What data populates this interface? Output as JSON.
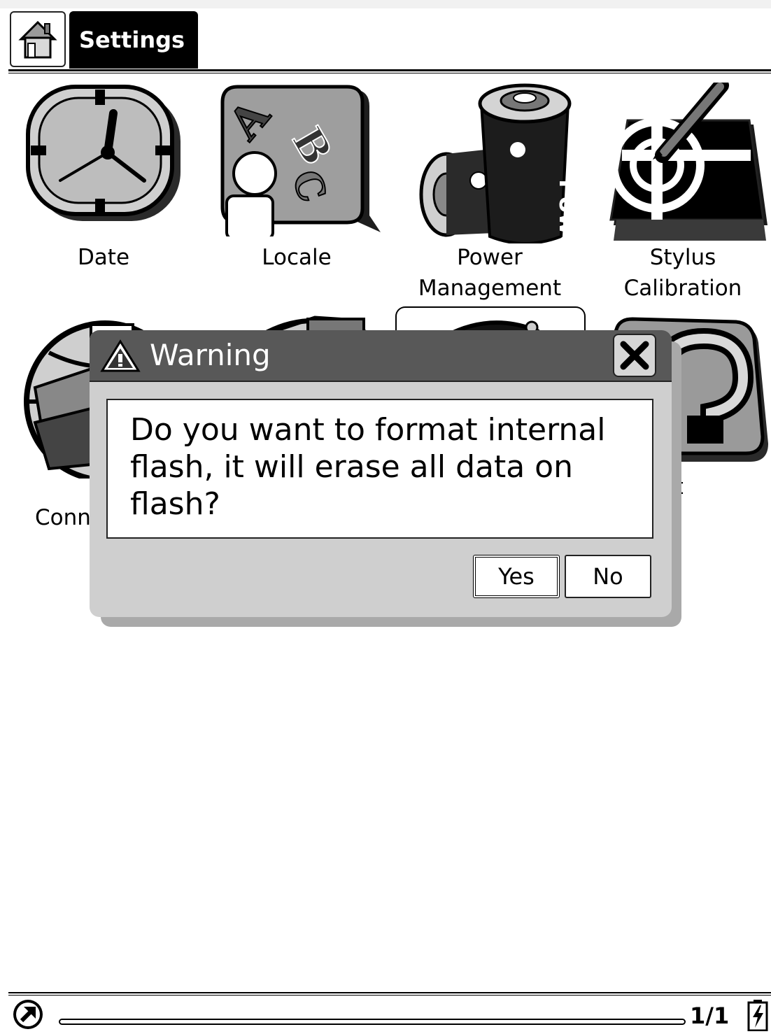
{
  "header": {
    "title": "Settings",
    "home_icon": "home-icon"
  },
  "settings_items": [
    {
      "label": "Date",
      "icon": "clock-icon"
    },
    {
      "label": "Locale",
      "icon": "locale-abc-icon"
    },
    {
      "label": "Power\nManagement",
      "icon": "battery-power-icon"
    },
    {
      "label": "Stylus\nCalibration",
      "icon": "stylus-target-icon"
    },
    {
      "label": "Conn",
      "icon": "globe-connection-icon"
    },
    {
      "label": "",
      "icon": "globe-icon"
    },
    {
      "label": "",
      "icon": "format-icon"
    },
    {
      "label": "out",
      "icon": "help-question-icon"
    }
  ],
  "dialog": {
    "title": "Warning",
    "message": "Do you want to format internal flash, it will erase all data on flash?",
    "yes_label": "Yes",
    "no_label": "No"
  },
  "footer": {
    "page": "1/1"
  }
}
